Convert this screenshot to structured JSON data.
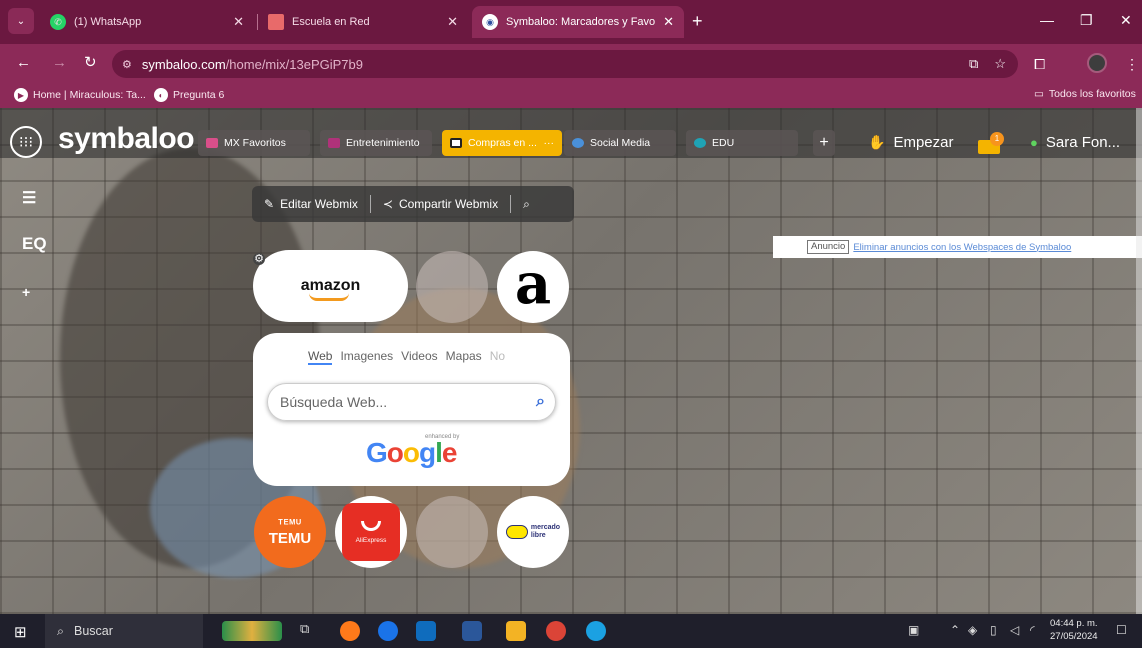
{
  "browser": {
    "tabs": [
      {
        "title": "(1) WhatsApp",
        "icon": "whatsapp-icon"
      },
      {
        "title": "Escuela en Red",
        "icon": "bookmark-icon"
      },
      {
        "title": "Symbaloo: Marcadores y Favoritos",
        "icon": "symbaloo-icon",
        "active": true
      }
    ],
    "url_host": "symbaloo.com",
    "url_path": "/home/mix/13ePGiP7b9",
    "bookmarks": [
      {
        "label": "Home | Miraculous: Ta...",
        "icon": "play-icon"
      },
      {
        "label": "Pregunta 6",
        "icon": "chrome-icon"
      }
    ],
    "all_bookmarks": "Todos los favoritos",
    "accent": "#8c2a58"
  },
  "symbaloo": {
    "logo": "symbaloo",
    "webmix_tabs": [
      {
        "label": "MX Favoritos",
        "color": "#d94f8a"
      },
      {
        "label": "Entretenimiento",
        "color": "#b0327a"
      },
      {
        "label": "Compras en ...",
        "color": "#f4b400",
        "active": true,
        "more": "···"
      },
      {
        "label": "Social Media",
        "color": "#4a90d9"
      },
      {
        "label": "EDU",
        "color": "#1fa3b5"
      }
    ],
    "empezar": "Empezar",
    "notification_count": "1",
    "user": "Sara Fon...",
    "toolbar": {
      "edit": "Editar Webmix",
      "share": "Compartir Webmix"
    },
    "ad": {
      "tag": "Anuncio",
      "link": "Eliminar anuncios con los Webspaces de Symbaloo"
    },
    "tiles": {
      "amazon": "amazon",
      "amazon_a": "a",
      "temu_top": "ᵀᴱᴹᵁ",
      "temu": "TEMU",
      "aliexpress": "AliExpress",
      "mercadolibre_1": "mercado",
      "mercadolibre_2": "libre"
    },
    "search": {
      "tabs": [
        "Web",
        "Imagenes",
        "Videos",
        "Mapas",
        "No"
      ],
      "placeholder": "Búsqueda Web...",
      "enhanced": "enhanced by",
      "brand": "Google"
    }
  },
  "taskbar": {
    "search": "Buscar",
    "time": "04:44 p. m.",
    "date": "27/05/2024"
  }
}
